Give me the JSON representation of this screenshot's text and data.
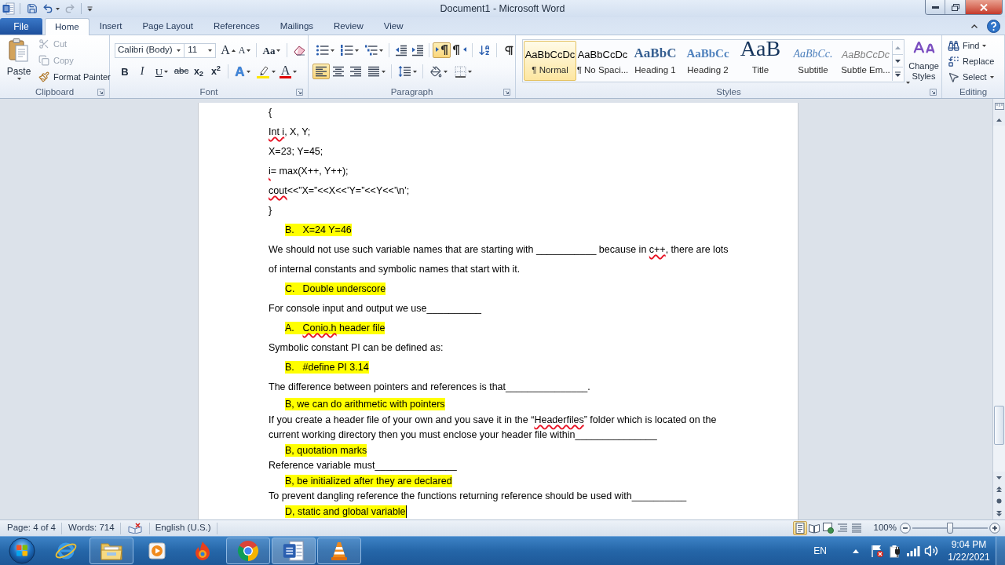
{
  "title_bar": {
    "title": "Document1 - Microsoft Word",
    "quick_access": [
      {
        "kind": "save",
        "disabled": false
      },
      {
        "kind": "undo",
        "disabled": false
      },
      {
        "kind": "redo",
        "disabled": true
      }
    ]
  },
  "ribbon_tabs": [
    {
      "label": "File",
      "kind": "file",
      "selected": false
    },
    {
      "label": "Home",
      "kind": "tab",
      "selected": true
    },
    {
      "label": "Insert",
      "kind": "tab",
      "selected": false
    },
    {
      "label": "Page Layout",
      "kind": "tab",
      "selected": false
    },
    {
      "label": "References",
      "kind": "tab",
      "selected": false
    },
    {
      "label": "Mailings",
      "kind": "tab",
      "selected": false
    },
    {
      "label": "Review",
      "kind": "tab",
      "selected": false
    },
    {
      "label": "View",
      "kind": "tab",
      "selected": false
    }
  ],
  "clipboard": {
    "label": "Clipboard",
    "paste": "Paste",
    "commands": [
      {
        "kind": "cut",
        "label": "Cut",
        "disabled": true
      },
      {
        "kind": "copy",
        "label": "Copy",
        "disabled": true
      },
      {
        "kind": "format_painter",
        "label": "Format Painter",
        "disabled": false
      }
    ]
  },
  "font": {
    "label": "Font",
    "font_name": "Calibri (Body)",
    "font_size": "11",
    "grow": "A",
    "shrink": "A",
    "change_case": "Aa",
    "formats": [
      {
        "kind": "bold",
        "glyph": "B"
      },
      {
        "kind": "italic",
        "glyph": "I"
      },
      {
        "kind": "underline",
        "glyph": "U"
      },
      {
        "kind": "strikethrough",
        "glyph": "abc"
      },
      {
        "kind": "subscript",
        "glyph": "x$_{2}$"
      },
      {
        "kind": "superscript",
        "glyph": "x$^{2}$"
      }
    ],
    "text_effects": "A",
    "font_color": "A"
  },
  "paragraph": {
    "label": "Paragraph",
    "text_direction": [
      {
        "kind": "ltr",
        "selected": true
      },
      {
        "kind": "rtl",
        "selected": false
      }
    ],
    "alignment": [
      {
        "kind": "left",
        "selected": true
      },
      {
        "kind": "center",
        "selected": false
      },
      {
        "kind": "right",
        "selected": false
      },
      {
        "kind": "justify",
        "selected": false
      }
    ]
  },
  "styles": {
    "label": "Styles",
    "gallery": [
      {
        "kind": "normal",
        "sample": "AaBbCcDc",
        "name": "¶ Normal",
        "selected": true
      },
      {
        "kind": "no_spacing",
        "sample": "AaBbCcDc",
        "name": "¶ No Spaci...",
        "selected": false
      },
      {
        "kind": "heading1",
        "sample": "AaBbC",
        "name": "Heading 1",
        "selected": false
      },
      {
        "kind": "heading2",
        "sample": "AaBbCc",
        "name": "Heading 2",
        "selected": false
      },
      {
        "kind": "title",
        "sample": "AaB",
        "name": "Title",
        "selected": false
      },
      {
        "kind": "subtitle",
        "sample": "AaBbCc.",
        "name": "Subtitle",
        "selected": false
      },
      {
        "kind": "subtle_emphasis",
        "sample": "AaBbCcDc",
        "name": "Subtle Em...",
        "selected": false
      }
    ],
    "change_styles": "Change Styles"
  },
  "editing": {
    "label": "Editing",
    "commands": [
      {
        "kind": "find",
        "label": "Find"
      },
      {
        "kind": "replace",
        "label": "Replace"
      },
      {
        "kind": "select",
        "label": "Select"
      }
    ]
  },
  "document": {
    "sections": [
      {
        "paragraphs": [
          {
            "kind": "code",
            "lines": [
              [
                {
                  "text": "{",
                  "misspelled": false
                }
              ]
            ]
          },
          {
            "kind": "code",
            "lines": [
              [
                {
                  "text": "Int i",
                  "misspelled": true
                },
                {
                  "text": ", X, Y;",
                  "misspelled": false
                }
              ]
            ]
          },
          {
            "kind": "code",
            "lines": [
              [
                {
                  "text": "X=23; Y=45;",
                  "misspelled": false
                }
              ]
            ]
          },
          {
            "kind": "code",
            "lines": [
              [
                {
                  "text": "i",
                  "misspelled": true
                },
                {
                  "text": "= max(X++, Y++);",
                  "misspelled": false
                }
              ]
            ]
          },
          {
            "kind": "code",
            "lines": [
              [
                {
                  "text": "cout",
                  "misspelled": true
                },
                {
                  "text": "<<”X=”<<X<<’Y=”<<Y<<’\\n’;",
                  "misspelled": false
                }
              ]
            ]
          },
          {
            "kind": "code",
            "lines": [
              [
                {
                  "text": "}",
                  "misspelled": false
                }
              ]
            ]
          },
          {
            "kind": "answer",
            "marker": "B.",
            "lines": [
              [
                {
                  "text": "X=24 Y=46",
                  "misspelled": false
                }
              ]
            ],
            "caret": false
          },
          {
            "kind": "text",
            "lines": [
              [
                {
                  "text": "We should not use such variable names that are starting with ___________ because in ",
                  "misspelled": false
                },
                {
                  "text": "c++",
                  "misspelled": true
                },
                {
                  "text": ", there are lots",
                  "misspelled": false
                }
              ],
              [
                {
                  "text": "of internal constants and symbolic names that start with it.",
                  "misspelled": false
                }
              ]
            ]
          },
          {
            "kind": "answer",
            "marker": "C.",
            "lines": [
              [
                {
                  "text": "Double underscore",
                  "misspelled": false
                }
              ]
            ],
            "caret": false
          },
          {
            "kind": "text",
            "lines": [
              [
                {
                  "text": "For console input and output we use__________",
                  "misspelled": false
                }
              ]
            ]
          },
          {
            "kind": "answer",
            "marker": "A.",
            "lines": [
              [
                {
                  "text": "Conio.h",
                  "misspelled": true
                },
                {
                  "text": " header file",
                  "misspelled": false
                }
              ]
            ],
            "caret": false
          },
          {
            "kind": "text",
            "lines": [
              [
                {
                  "text": "Symbolic constant PI can be defined as:",
                  "misspelled": false
                }
              ]
            ]
          },
          {
            "kind": "answer",
            "marker": "B.",
            "lines": [
              [
                {
                  "text": "#define PI 3.14",
                  "misspelled": false
                }
              ]
            ],
            "caret": false
          },
          {
            "kind": "text",
            "lines": [
              [
                {
                  "text": "The difference between pointers and references is that_______________.",
                  "misspelled": false
                }
              ]
            ]
          }
        ]
      },
      {
        "paragraphs": [
          {
            "kind": "answer",
            "lines": [
              [
                {
                  "text": "B, we can do arithmetic with pointers",
                  "misspelled": false
                }
              ]
            ],
            "caret": false
          },
          {
            "kind": "text",
            "lines": [
              [
                {
                  "text": "If you create a header file of your own and you save it in the “",
                  "misspelled": false
                },
                {
                  "text": "Headerfiles",
                  "misspelled": true
                },
                {
                  "text": "” folder which is located on the",
                  "misspelled": false
                }
              ],
              [
                {
                  "text": "current working directory then you must enclose your header file within_______________",
                  "misspelled": false
                }
              ]
            ]
          },
          {
            "kind": "answer",
            "lines": [
              [
                {
                  "text": "B, quotation marks",
                  "misspelled": false
                }
              ]
            ],
            "caret": false
          },
          {
            "kind": "text",
            "lines": [
              [
                {
                  "text": "Reference variable must_______________",
                  "misspelled": false
                }
              ]
            ]
          },
          {
            "kind": "answer",
            "lines": [
              [
                {
                  "text": "B, be initialized after they are declared",
                  "misspelled": false
                }
              ]
            ],
            "caret": false
          },
          {
            "kind": "text",
            "lines": [
              [
                {
                  "text": "To prevent dangling reference the functions returning reference should be used with__________",
                  "misspelled": false
                }
              ]
            ]
          },
          {
            "kind": "answer",
            "lines": [
              [
                {
                  "text": "D, static and global variable",
                  "misspelled": false
                }
              ]
            ],
            "caret": true
          }
        ]
      }
    ]
  },
  "status_bar": {
    "page": "Page: 4 of 4",
    "words": "Words: 714",
    "language": "English (U.S.)",
    "views": [
      {
        "kind": "print_layout",
        "selected": true
      },
      {
        "kind": "full_screen_reading",
        "selected": false
      },
      {
        "kind": "web_layout",
        "selected": false
      },
      {
        "kind": "outline",
        "selected": false
      },
      {
        "kind": "draft",
        "selected": false
      }
    ],
    "zoom": "100%",
    "zoom_slider": {
      "level": 0.5
    }
  },
  "taskbar": {
    "apps": [
      {
        "kind": "ie",
        "running": false,
        "selected": false
      },
      {
        "kind": "explorer",
        "running": true,
        "selected": false
      },
      {
        "kind": "media_player",
        "running": false,
        "selected": false
      },
      {
        "kind": "flame_browser",
        "running": false,
        "selected": false
      },
      {
        "kind": "chrome",
        "running": true,
        "selected": false
      },
      {
        "kind": "word",
        "running": true,
        "selected": true
      },
      {
        "kind": "vlc",
        "running": true,
        "selected": false
      }
    ],
    "language": "EN",
    "time": "9:04 PM",
    "date": "1/22/2021"
  }
}
